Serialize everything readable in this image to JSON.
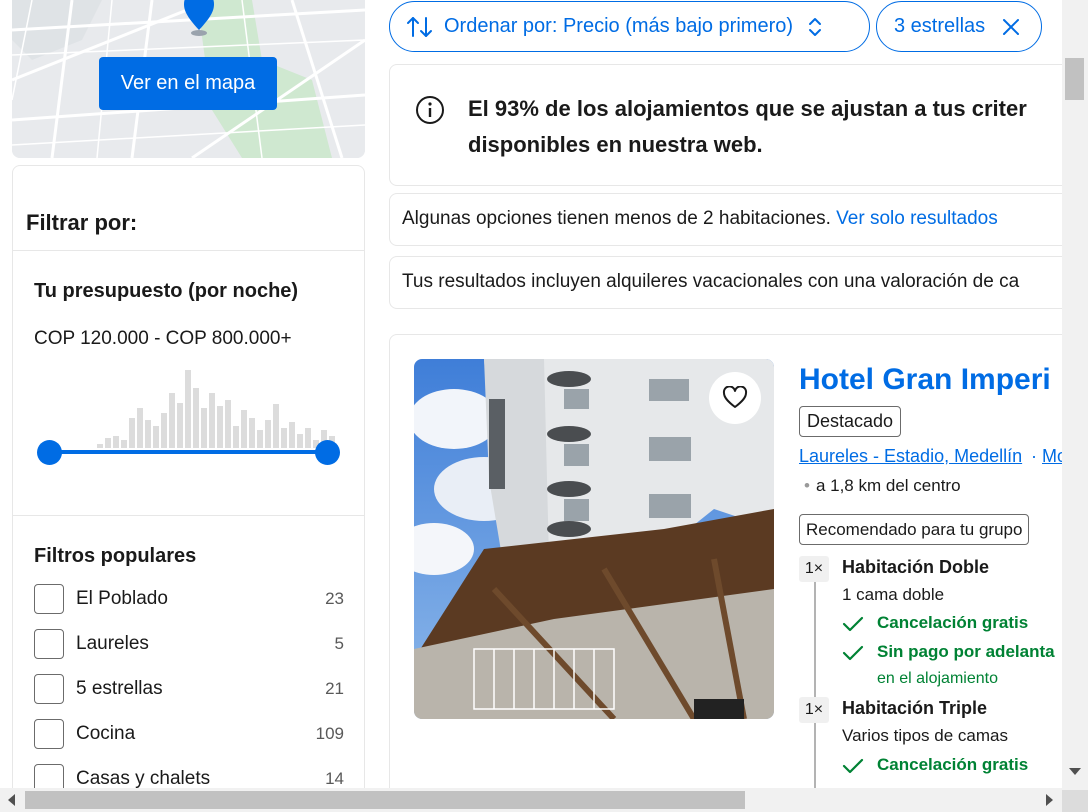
{
  "colors": {
    "accent": "#006ce4",
    "success": "#008234",
    "border": "#e7e7e7"
  },
  "map": {
    "button_label": "Ver en el mapa",
    "pin_icon": "map-pin-icon"
  },
  "filters": {
    "title": "Filtrar por:",
    "budget": {
      "title": "Tu presupuesto (por noche)",
      "range": "COP 120.000 - COP 800.000+",
      "slider_min_fraction": 0,
      "slider_max_fraction": 1
    },
    "popular": {
      "title": "Filtros populares",
      "items": [
        {
          "label": "El Poblado",
          "count": "23"
        },
        {
          "label": "Laureles",
          "count": "5"
        },
        {
          "label": "5 estrellas",
          "count": "21"
        },
        {
          "label": "Cocina",
          "count": "109"
        },
        {
          "label": "Casas y chalets",
          "count": "14"
        }
      ]
    }
  },
  "sort": {
    "label": "Ordenar por: Precio (más bajo primero)",
    "icon": "sort-icon"
  },
  "active_filter": {
    "label": "3 estrellas",
    "icon": "close-icon"
  },
  "notices": {
    "availability": "El 93% de los alojamientos que se ajustan a tus criter",
    "availability_line2": "disponibles en nuestra web.",
    "rooms_text": "Algunas opciones tienen menos de 2 habitaciones. ",
    "rooms_link": "Ver solo resultados",
    "rentals_text": "Tus resultados incluyen alquileres vacacionales con una valoración de ca"
  },
  "property": {
    "name": "Hotel Gran Imperi",
    "badge": "Destacado",
    "location": "Laureles - Estadio, Medellín",
    "location_sep": "·",
    "location_more": "Mo",
    "distance_dot": "•",
    "distance": "a 1,8 km del centro",
    "group_badge": "Recomendado para tu grupo",
    "favorite_icon": "heart-icon",
    "rooms": [
      {
        "qty": "1×",
        "title": "Habitación Doble",
        "beds": "1 cama doble",
        "perks": [
          "Cancelación gratis",
          "Sin pago por adelanta"
        ],
        "perk_sub": "en el alojamiento"
      },
      {
        "qty": "1×",
        "title": "Habitación Triple",
        "beds": "Varios tipos de camas",
        "perks": [
          "Cancelación gratis"
        ]
      }
    ]
  }
}
